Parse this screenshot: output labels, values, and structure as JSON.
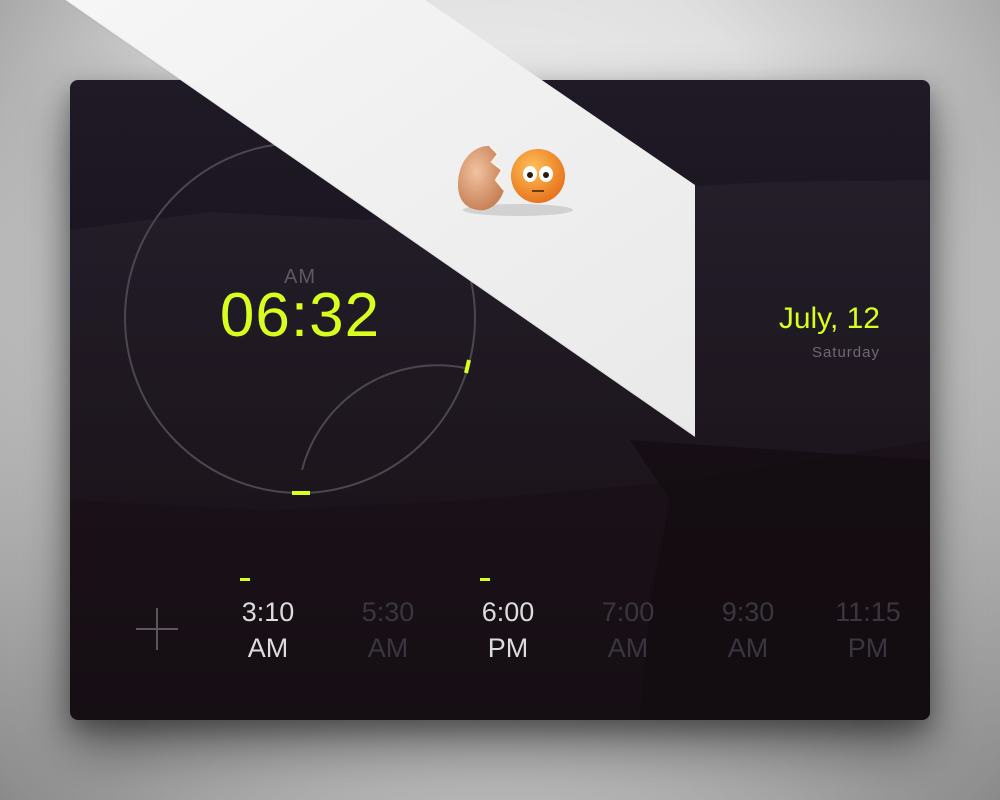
{
  "clock": {
    "period": "AM",
    "time": "06:32"
  },
  "date": {
    "label": "July, 12",
    "weekday": "Saturday"
  },
  "add_button": {
    "icon": "plus-icon"
  },
  "alarms": [
    {
      "time": "3:10",
      "period": "AM",
      "active": true
    },
    {
      "time": "5:30",
      "period": "AM",
      "active": false
    },
    {
      "time": "6:00",
      "period": "PM",
      "active": true
    },
    {
      "time": "7:00",
      "period": "AM",
      "active": false
    },
    {
      "time": "9:30",
      "period": "AM",
      "active": false
    },
    {
      "time": "11:15",
      "period": "PM",
      "active": false
    }
  ],
  "decoration": {
    "icon": "cracked-egg-emoji-icon"
  },
  "colors": {
    "accent": "#d8ff1d",
    "card_bg": "#1a1520",
    "dim_text": "#3a3640",
    "active_text": "#dcdcdc"
  }
}
